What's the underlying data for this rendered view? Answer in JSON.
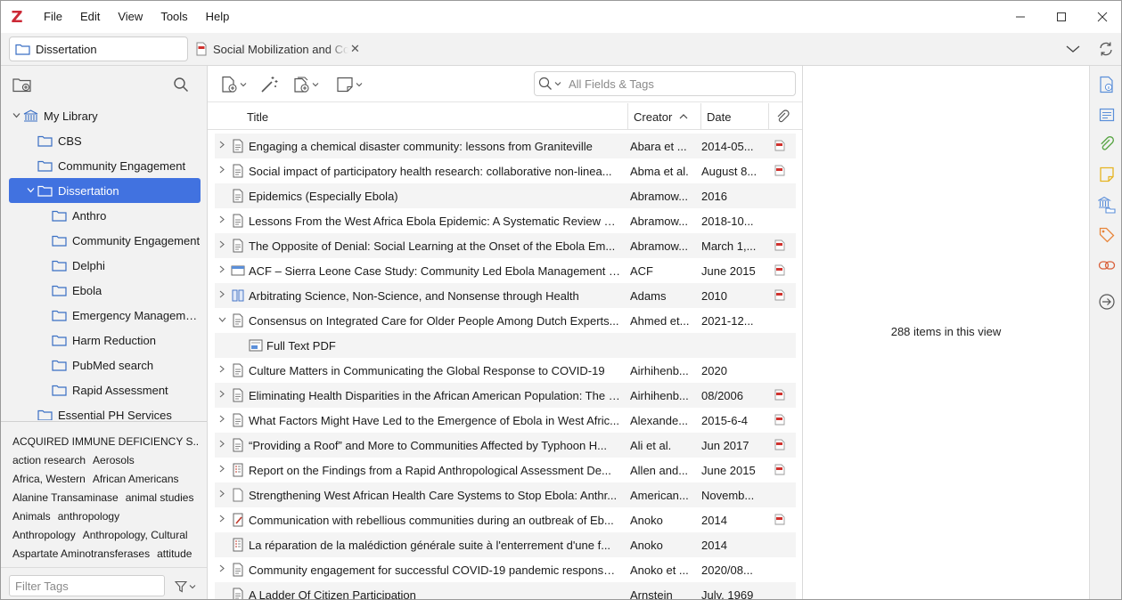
{
  "app": {
    "logo": "Z"
  },
  "menu": [
    "File",
    "Edit",
    "View",
    "Tools",
    "Help"
  ],
  "tabs": {
    "library_tab": "Dissertation",
    "document_tab": "Social Mobilization and Community Engagement"
  },
  "collections": [
    {
      "label": "My Library",
      "level": 0,
      "expanded": true,
      "icon": "library-icon"
    },
    {
      "label": "CBS",
      "level": 1,
      "icon": "folder-icon"
    },
    {
      "label": "Community Engagement",
      "level": 1,
      "icon": "folder-icon"
    },
    {
      "label": "Dissertation",
      "level": 1,
      "expanded": true,
      "selected": true,
      "icon": "folder-icon"
    },
    {
      "label": "Anthro",
      "level": 2,
      "icon": "folder-icon"
    },
    {
      "label": "Community Engagement",
      "level": 2,
      "icon": "folder-icon"
    },
    {
      "label": "Delphi",
      "level": 2,
      "icon": "folder-icon"
    },
    {
      "label": "Ebola",
      "level": 2,
      "icon": "folder-icon"
    },
    {
      "label": "Emergency Manageme...",
      "level": 2,
      "icon": "folder-icon"
    },
    {
      "label": "Harm Reduction",
      "level": 2,
      "icon": "folder-icon"
    },
    {
      "label": "PubMed search",
      "level": 2,
      "icon": "folder-icon"
    },
    {
      "label": "Rapid Assessment",
      "level": 2,
      "icon": "folder-icon"
    },
    {
      "label": "Essential PH Services",
      "level": 1,
      "icon": "folder-icon"
    }
  ],
  "tags": [
    [
      "ACQUIRED IMMUNE DEFICIENCY S..."
    ],
    [
      "action research",
      "Aerosols"
    ],
    [
      "Africa, Western",
      "African Americans"
    ],
    [
      "Alanine Transaminase",
      "animal studies"
    ],
    [
      "Animals",
      "anthropology"
    ],
    [
      "Anthropology",
      "Anthropology, Cultural"
    ],
    [
      "Aspartate Aminotransferases",
      "attitude"
    ]
  ],
  "tag_filter": {
    "placeholder": "Filter Tags"
  },
  "search": {
    "placeholder": "All Fields & Tags"
  },
  "columns": {
    "title": "Title",
    "creator": "Creator",
    "date": "Date",
    "sort_indicator": "^"
  },
  "items": [
    {
      "twisty": ">",
      "type": "document",
      "title": "Engaging a chemical disaster community: lessons from Graniteville",
      "creator": "Abara et ...",
      "date": "2014-05...",
      "pdf": true
    },
    {
      "twisty": ">",
      "type": "document",
      "title": "Social impact of participatory health research: collaborative non-linea...",
      "creator": "Abma et al.",
      "date": "August 8...",
      "pdf": true
    },
    {
      "twisty": "",
      "type": "document",
      "title": "Epidemics (Especially Ebola)",
      "creator": "Abramow...",
      "date": "2016",
      "pdf": false
    },
    {
      "twisty": ">",
      "type": "document",
      "title": "Lessons From the West Africa Ebola Epidemic: A Systematic Review of...",
      "creator": "Abramow...",
      "date": "2018-10...",
      "pdf": false
    },
    {
      "twisty": ">",
      "type": "document",
      "title": "The Opposite of Denial: Social Learning at the Onset of the Ebola Em...",
      "creator": "Abramow...",
      "date": "March 1,...",
      "pdf": true
    },
    {
      "twisty": ">",
      "type": "webpage",
      "title": "ACF – Sierra Leone Case Study: Community Led Ebola Management a...",
      "creator": "ACF",
      "date": "June 2015",
      "pdf": true
    },
    {
      "twisty": ">",
      "type": "book",
      "title": "Arbitrating Science, Non-Science, and Nonsense through Health",
      "creator": "Adams",
      "date": "2010",
      "pdf": true
    },
    {
      "twisty": "v",
      "type": "document",
      "title": "Consensus on Integrated Care for Older People Among Dutch Experts...",
      "creator": "Ahmed et...",
      "date": "2021-12...",
      "pdf": false
    },
    {
      "twisty": "",
      "type": "attachment",
      "child": true,
      "title": "Full Text PDF",
      "creator": "",
      "date": "",
      "pdf": false
    },
    {
      "twisty": ">",
      "type": "document",
      "title": "Culture Matters in Communicating the Global Response to COVID-19",
      "creator": "Airhihenb...",
      "date": "2020",
      "pdf": false
    },
    {
      "twisty": ">",
      "type": "document",
      "title": "Eliminating Health Disparities in the African American Population: The I...",
      "creator": "Airhihenb...",
      "date": "08/2006",
      "pdf": true
    },
    {
      "twisty": ">",
      "type": "document",
      "title": "What Factors Might Have Led to the Emergence of Ebola in West Afric...",
      "creator": "Alexande...",
      "date": "2015-6-4",
      "pdf": true
    },
    {
      "twisty": ">",
      "type": "document",
      "title": "“Providing a Roof” and More to Communities Affected by Typhoon H...",
      "creator": "Ali et al.",
      "date": "Jun 2017",
      "pdf": true
    },
    {
      "twisty": ">",
      "type": "report",
      "title": "Report on the Findings from a Rapid Anthropological Assessment De...",
      "creator": "Allen and...",
      "date": "June 2015",
      "pdf": true
    },
    {
      "twisty": ">",
      "type": "blank",
      "title": "Strengthening West African Health Care Systems to Stop Ebola: Anthr...",
      "creator": "American...",
      "date": "Novemb...",
      "pdf": false
    },
    {
      "twisty": ">",
      "type": "manuscript",
      "title": "Communication with rebellious communities during an outbreak of Eb...",
      "creator": "Anoko",
      "date": "2014",
      "pdf": true
    },
    {
      "twisty": "",
      "type": "report",
      "title": "La réparation de la malédiction générale suite à l'enterrement d'une f...",
      "creator": "Anoko",
      "date": "2014",
      "pdf": false
    },
    {
      "twisty": ">",
      "type": "document",
      "title": "Community engagement for successful COVID-19 pandemic response:...",
      "creator": "Anoko et ...",
      "date": "2020/08...",
      "pdf": false
    },
    {
      "twisty": "",
      "type": "document",
      "title": "A Ladder Of Citizen Participation",
      "creator": "Arnstein",
      "date": "July, 1969",
      "pdf": false
    }
  ],
  "item_pane": {
    "message": "288 items in this view"
  },
  "colors": {
    "accent": "#4172e0",
    "logo": "#cc2936",
    "pdf": "#d0312d",
    "sidenav_blue": "#5b8fd9",
    "attach_green": "#5aa646",
    "note_yellow": "#e6b422",
    "tag_orange": "#e8853a",
    "related_red": "#d9603b"
  }
}
